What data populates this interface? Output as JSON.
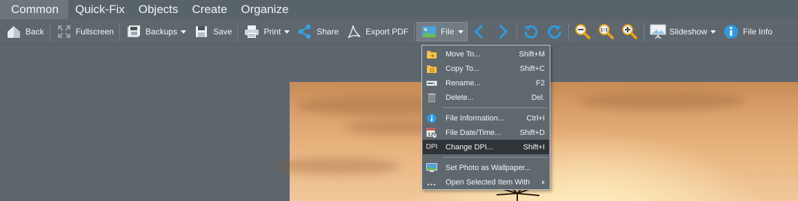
{
  "tabs": [
    {
      "label": "Common",
      "active": true
    },
    {
      "label": "Quick-Fix",
      "active": false
    },
    {
      "label": "Objects",
      "active": false
    },
    {
      "label": "Create",
      "active": false
    },
    {
      "label": "Organize",
      "active": false
    }
  ],
  "toolbar": {
    "back": "Back",
    "fullscreen": "Fullscreen",
    "backups": "Backups",
    "save": "Save",
    "print": "Print",
    "share": "Share",
    "export_pdf": "Export PDF",
    "file": "File",
    "slideshow": "Slideshow",
    "file_info": "File Info"
  },
  "file_menu": {
    "items": [
      {
        "label": "Move To...",
        "shortcut": "Shift+M",
        "icon": "folder-move-icon"
      },
      {
        "label": "Copy To...",
        "shortcut": "Shift+C",
        "icon": "folder-copy-icon"
      },
      {
        "label": "Rename...",
        "shortcut": "F2",
        "icon": "rename-icon"
      },
      {
        "label": "Delete...",
        "shortcut": "Del.",
        "icon": "trash-icon"
      },
      {
        "label": "File Information...",
        "shortcut": "Ctrl+I",
        "icon": "info-icon"
      },
      {
        "label": "File Date/Time...",
        "shortcut": "Shift+D",
        "icon": "calendar-icon"
      },
      {
        "label": "Change DPI...",
        "shortcut": "Shift+I",
        "icon": "dpi-icon",
        "icon_text": "DPI",
        "highlighted": true
      },
      {
        "label": "Set Photo as Wallpaper...",
        "shortcut": "",
        "icon": "wallpaper-icon"
      },
      {
        "label": "Open Selected Item With",
        "shortcut": "",
        "icon": "more-icon",
        "icon_text": "...",
        "submenu": true
      }
    ]
  },
  "colors": {
    "background": "#5d666d",
    "accent_blue": "#2a9ae0",
    "menu_highlight": "#2f3439"
  }
}
